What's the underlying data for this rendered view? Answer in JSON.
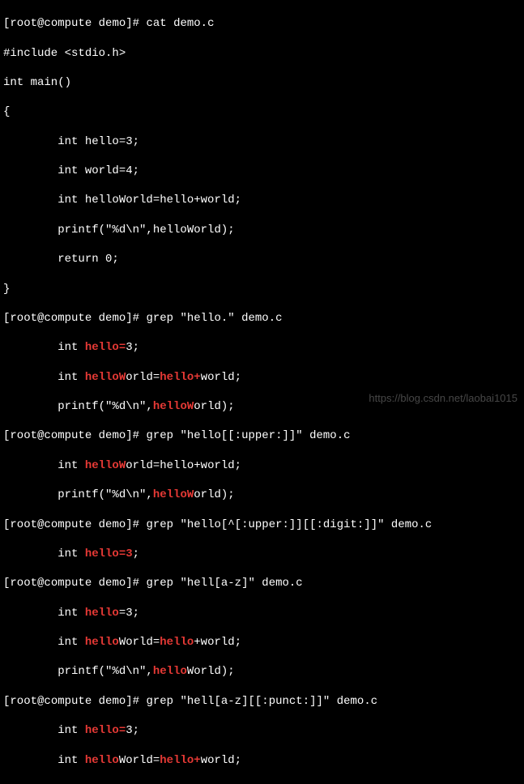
{
  "prompt": {
    "user": "root",
    "host": "compute",
    "cwd": "demo",
    "symbol": "#"
  },
  "cmd": {
    "cat": "cat demo.c",
    "grep1": "grep \"hello.\" demo.c",
    "grep2": "grep \"hello[[:upper:]]\" demo.c",
    "grep3": "grep \"hello[^[:upper:]][[:digit:]]\" demo.c",
    "grep4": "grep \"hell[a-z]\" demo.c",
    "grep5": "grep \"hell[a-z][[:punct:]]\" demo.c"
  },
  "source": {
    "l1": "#include <stdio.h>",
    "l2": "int main()",
    "l3": "{",
    "l4": "        int hello=3;",
    "l5": "        int world=4;",
    "l6": "        int helloWorld=hello+world;",
    "l7": "        printf(\"%d\\n\",helloWorld);",
    "l8": "        return 0;",
    "l9": "}"
  },
  "out1": {
    "a": {
      "pre": "        int ",
      "h1": "hello=",
      "post": "3;"
    },
    "b": {
      "pre": "        int ",
      "h1": "helloW",
      "mid": "orld=",
      "h2": "hello+",
      "post": "world;"
    },
    "c": {
      "pre": "        printf(\"%d\\n\",",
      "h1": "helloW",
      "post": "orld);"
    }
  },
  "out2": {
    "a": {
      "pre": "        int ",
      "h1": "helloW",
      "mid": "orld=hello+world;"
    },
    "b": {
      "pre": "        printf(\"%d\\n\",",
      "h1": "helloW",
      "post": "orld);"
    }
  },
  "out3": {
    "a": {
      "pre": "        int ",
      "h1": "hello=3",
      "post": ";"
    }
  },
  "out4": {
    "a": {
      "pre": "        int ",
      "h1": "hello",
      "post": "=3;"
    },
    "b": {
      "pre": "        int ",
      "h1": "hello",
      "mid": "World=",
      "h2": "hello",
      "post": "+world;"
    },
    "c": {
      "pre": "        printf(\"%d\\n\",",
      "h1": "hello",
      "post": "World);"
    }
  },
  "out5": {
    "a": {
      "pre": "        int ",
      "h1": "hello=",
      "post": "3;"
    },
    "b": {
      "pre": "        int ",
      "h1": "hello",
      "mid": "World=",
      "h2": "hello+",
      "post": "world;"
    }
  },
  "watermark": "https://blog.csdn.net/laobai1015"
}
